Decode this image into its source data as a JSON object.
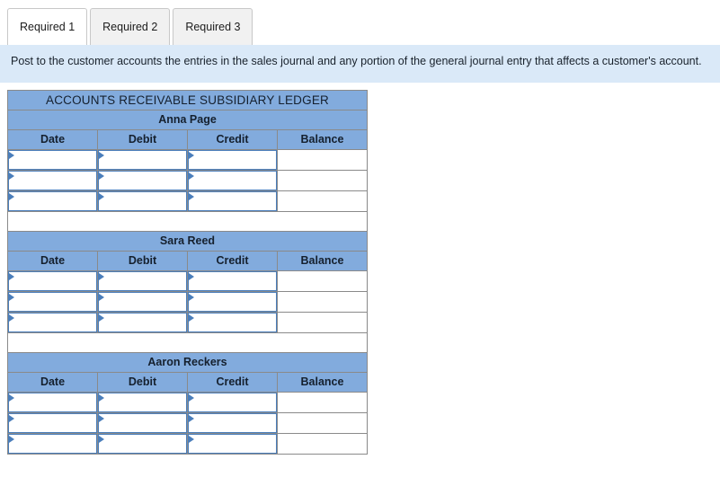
{
  "tabs": [
    {
      "label": "Required 1",
      "active": true
    },
    {
      "label": "Required 2",
      "active": false
    },
    {
      "label": "Required 3",
      "active": false
    }
  ],
  "instructions": {
    "text": "Post to the customer accounts the entries in the sales journal and any portion of the general journal entry that affects a customer's account."
  },
  "ledger": {
    "title": "ACCOUNTS RECEIVABLE SUBSIDIARY LEDGER",
    "columns": [
      "Date",
      "Debit",
      "Credit",
      "Balance"
    ],
    "accounts": [
      {
        "name": "Anna Page",
        "rows": [
          {
            "date": "",
            "debit": "",
            "credit": "",
            "balance": ""
          },
          {
            "date": "",
            "debit": "",
            "credit": "",
            "balance": ""
          },
          {
            "date": "",
            "debit": "",
            "credit": "",
            "balance": ""
          }
        ]
      },
      {
        "name": "Sara Reed",
        "rows": [
          {
            "date": "",
            "debit": "",
            "credit": "",
            "balance": ""
          },
          {
            "date": "",
            "debit": "",
            "credit": "",
            "balance": ""
          },
          {
            "date": "",
            "debit": "",
            "credit": "",
            "balance": ""
          }
        ]
      },
      {
        "name": "Aaron Reckers",
        "rows": [
          {
            "date": "",
            "debit": "",
            "credit": "",
            "balance": ""
          },
          {
            "date": "",
            "debit": "",
            "credit": "",
            "balance": ""
          },
          {
            "date": "",
            "debit": "",
            "credit": "",
            "balance": ""
          }
        ]
      }
    ]
  },
  "colors": {
    "header_blue": "#82abdd",
    "instruction_bg": "#dae9f8",
    "input_border": "#4a7ebb",
    "cell_border": "#8a8a8a",
    "tab_inactive": "#f1f1f1",
    "tab_active": "#ffffff"
  }
}
